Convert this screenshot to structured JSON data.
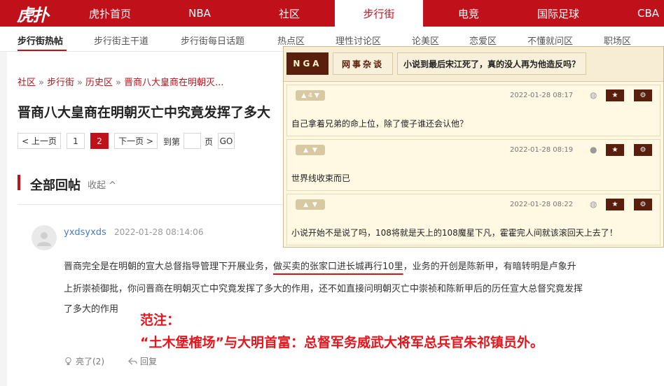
{
  "topnav": {
    "logo": "虎扑",
    "items": [
      {
        "label": "虎扑首页"
      },
      {
        "label": "NBA"
      },
      {
        "label": "社区"
      },
      {
        "label": "步行街"
      },
      {
        "label": "电竞"
      },
      {
        "label": "国际足球"
      },
      {
        "label": "CBA"
      }
    ]
  },
  "subnav": {
    "items": [
      {
        "label": "步行街热帖"
      },
      {
        "label": "步行街主干道"
      },
      {
        "label": "步行街每日话题"
      },
      {
        "label": "热点区"
      },
      {
        "label": "理性讨论区"
      },
      {
        "label": "论美区"
      },
      {
        "label": "恋爱区"
      },
      {
        "label": "不懂就问区"
      },
      {
        "label": "职场区"
      }
    ]
  },
  "breadcrumb": [
    "社区",
    "步行街",
    "历史区",
    "晋商八大皇商在明朝灭..."
  ],
  "breadcrumb_sep": "»",
  "title": "晋商八大皇商在明朝灭亡中究竟发挥了多大",
  "pagination": {
    "prev": "< 上一页",
    "pages": [
      "1",
      "2"
    ],
    "next": "下一页 >",
    "goto_label": "到第",
    "page_unit": "页",
    "go": "GO"
  },
  "replies": {
    "title": "全部回帖",
    "collapse": "收起 ^"
  },
  "post": {
    "username": "yxdsyxds",
    "time": "2022-01-28 08:14:06",
    "line1_a": "晋商完全是在明朝的宣大总督指导管理下开展业务，",
    "line1_b": "做买卖的张家口进长城再行10里",
    "line1_c": "，业务的开创是陈新甲，有暗转明是卢象升",
    "line2": "上折崇祯御批，你问晋商在明朝灭亡中究竟发挥了多大的作用，还不如直接问明朝灭亡中崇祯和陈新甲后的历任宣大总督究竟发挥",
    "line3": "了多大的作用",
    "note1": "范注：",
    "note2": "“土木堡榷场”与大明首富：总督军务威武大将军总兵官朱祁镇员外。",
    "like_label": "亮了(2)",
    "reply_label": "回复"
  },
  "nga": {
    "logo": "NGA",
    "forum": "网事杂谈",
    "topic": "小说到最后宋江死了，真的没人再为他造反吗？",
    "replies": [
      {
        "votes": "4",
        "time": "2022-01-28 08:17",
        "device": "android-icon",
        "text": "自己拿着兄弟的命上位，除了傻子谁还会认他？"
      },
      {
        "votes": "",
        "time": "2022-01-28 08:19",
        "device": "apple-icon",
        "text": "世界线收束而已"
      },
      {
        "votes": "",
        "time": "2022-01-28 08:22",
        "device": "android-icon",
        "text": "小说开始不是说了吗，108将就是天上的108魔星下凡，霍霍完人间就该滚回天上去了！"
      }
    ]
  },
  "colors": {
    "brand": "#c0101a",
    "nga_dark": "#5a1e0c",
    "note_red": "#e8151c"
  }
}
